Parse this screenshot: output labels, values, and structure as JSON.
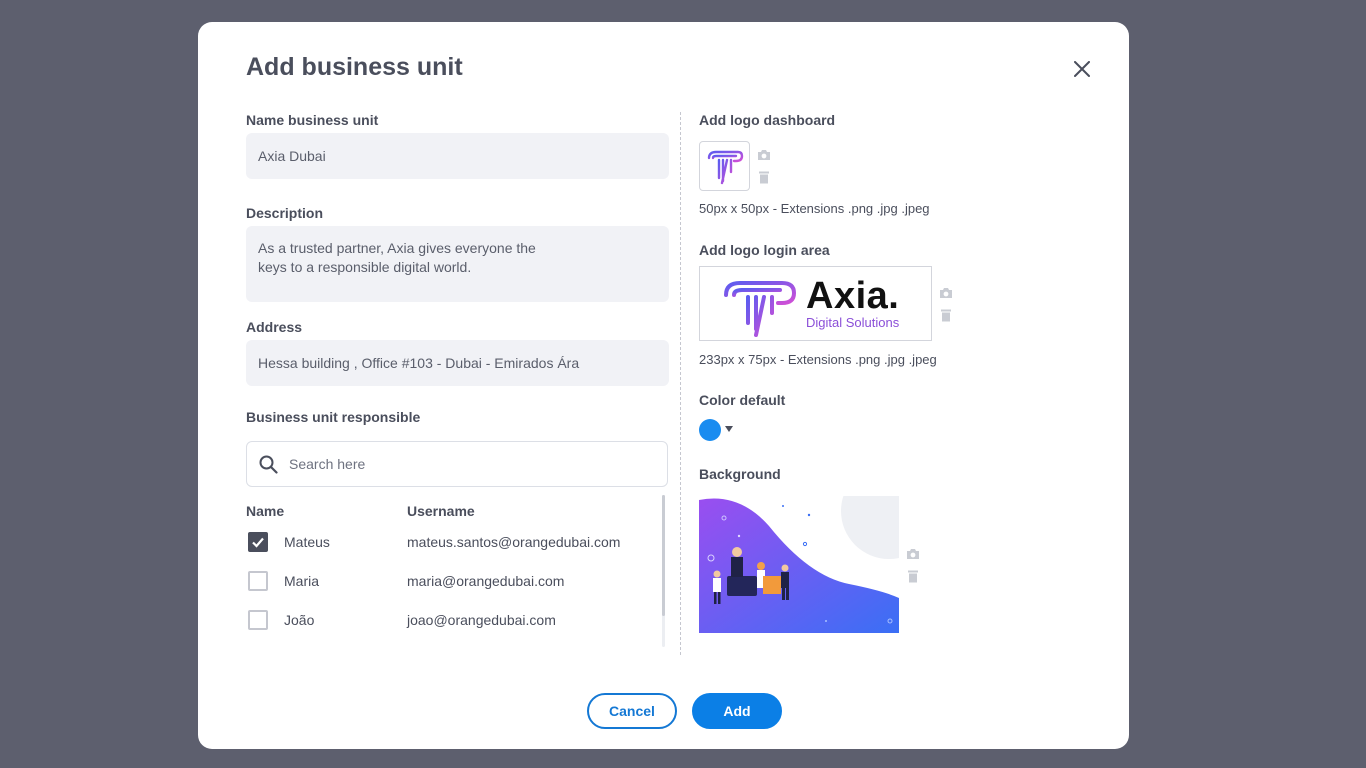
{
  "modal": {
    "title": "Add business unit",
    "close_icon": "close-icon"
  },
  "form": {
    "name_label": "Name business unit",
    "name_value": "Axia Dubai",
    "description_label": "Description",
    "description_value": "As a trusted partner, Axia gives everyone the\nkeys to a responsible digital world.",
    "address_label": "Address",
    "address_value": "Hessa building , Office #103 - Dubai - Emirados Ára",
    "responsible_label": "Business unit responsible",
    "search_placeholder": "Search here",
    "search_icon": "search-icon"
  },
  "table": {
    "headers": [
      "Name",
      "Username"
    ],
    "rows": [
      {
        "name": "Mateus",
        "username": "mateus.santos@orangedubai.com",
        "checked": true
      },
      {
        "name": "Maria",
        "username": "maria@orangedubai.com",
        "checked": false
      },
      {
        "name": "João",
        "username": "joao@orangedubai.com",
        "checked": false
      }
    ]
  },
  "right": {
    "logo_dashboard_label": "Add logo dashboard",
    "logo_dashboard_hint": "50px x 50px - Extensions .png .jpg .jpeg",
    "logo_login_label": "Add logo login area",
    "logo_login_hint": "233px x 75px - Extensions .png .jpg .jpeg",
    "logo_brand_name": "Axia.",
    "logo_brand_tagline": "Digital Solutions",
    "color_label": "Color default",
    "color_value": "#1a8cf0",
    "background_label": "Background",
    "camera_icon": "camera-icon",
    "trash_icon": "trash-icon"
  },
  "footer": {
    "cancel_label": "Cancel",
    "add_label": "Add"
  },
  "colors": {
    "primary": "#0b7fe6",
    "overlay": "#5d5f6e",
    "logo_gradient_start": "#6f4ef0",
    "logo_gradient_end": "#d14fd6"
  }
}
